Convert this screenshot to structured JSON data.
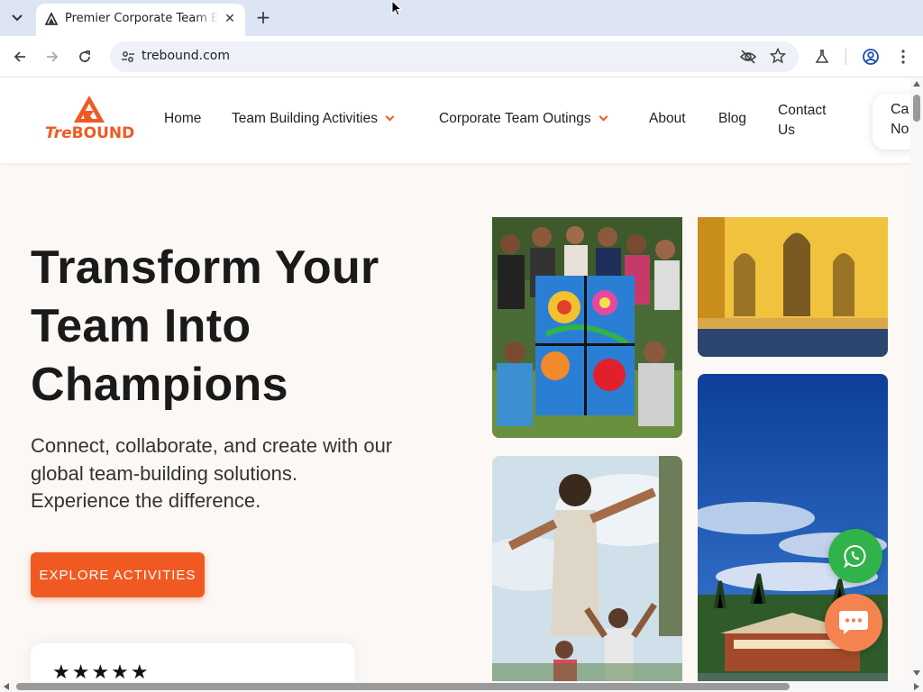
{
  "browser": {
    "tab_title": "Premier Corporate Team Building",
    "url": "trebound.com"
  },
  "site": {
    "logo_text_1": "Tre",
    "logo_text_2": "BOUND",
    "nav": {
      "home": "Home",
      "team_building": "Team Building Activities",
      "outings": "Corporate Team Outings",
      "about": "About",
      "blog": "Blog",
      "contact_line1": "Contact",
      "contact_line2": "Us",
      "call_line1": "Ca",
      "call_line2": "No"
    },
    "brand_color": "#f05a22"
  },
  "hero": {
    "title_line1": "Transform Your",
    "title_line2": "Team Into",
    "title_line3": "Champions",
    "subtitle_line1": "Connect, collaborate, and create with our",
    "subtitle_line2": "global team-building solutions.",
    "subtitle_line3": "Experience the difference.",
    "cta": "EXPLORE ACTIVITIES",
    "rating_stars": "★★★★★"
  },
  "icons": {
    "whatsapp": "whatsapp-icon",
    "chat": "chat-icon"
  }
}
